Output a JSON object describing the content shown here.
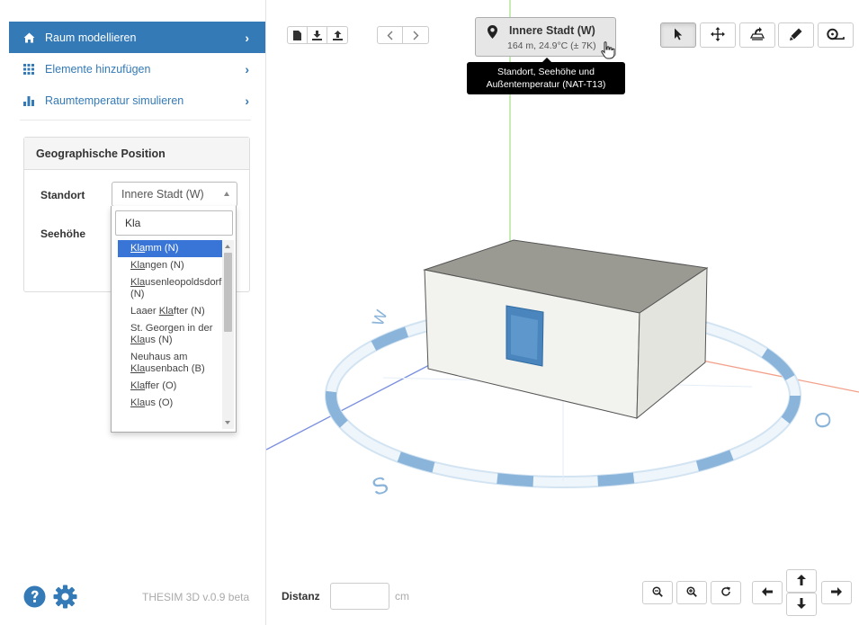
{
  "sidebar": {
    "nav": [
      {
        "label": "Raum modellieren",
        "icon": "home-icon",
        "active": true
      },
      {
        "label": "Elemente hinzufügen",
        "icon": "grid-icon",
        "active": false
      },
      {
        "label": "Raumtemperatur simulieren",
        "icon": "bar-chart-icon",
        "active": false
      }
    ],
    "panel": {
      "title": "Geographische Position",
      "location_label": "Standort",
      "altitude_label": "Seehöhe",
      "selected_location": "Innere Stadt (W)"
    },
    "dropdown": {
      "search_value": "Kla",
      "options": [
        {
          "before": "",
          "match": "Kla",
          "after": "mm (N)",
          "highlighted": true
        },
        {
          "before": "",
          "match": "Kla",
          "after": "ngen (N)",
          "highlighted": false
        },
        {
          "before": "",
          "match": "Kla",
          "after": "usenleopoldsdorf (N)",
          "highlighted": false
        },
        {
          "before": "Laaer ",
          "match": "Kla",
          "after": "fter (N)",
          "highlighted": false
        },
        {
          "before": "St. Georgen in der ",
          "match": "Kla",
          "after": "us (N)",
          "highlighted": false
        },
        {
          "before": "Neuhaus am ",
          "match": "Kla",
          "after": "usenbach (B)",
          "highlighted": false
        },
        {
          "before": "",
          "match": "Kla",
          "after": "ffer (O)",
          "highlighted": false
        },
        {
          "before": "",
          "match": "Kla",
          "after": "us (O)",
          "highlighted": false
        }
      ]
    },
    "footer": {
      "help_icon": "question-circle-icon",
      "settings_icon": "gear-icon",
      "version": "THESIM 3D v.0.9 beta"
    }
  },
  "location_button": {
    "title": "Innere Stadt (W)",
    "subtitle": "164 m, 24.9°C (± 7K)",
    "tooltip": [
      "Standort, Seehöhe und",
      "Außentemperatur (NAT-T13)"
    ]
  },
  "toolbar_left": [
    "new-file-icon",
    "download-icon",
    "upload-icon",
    "undo-icon",
    "redo-icon"
  ],
  "toolbar_right": [
    {
      "icon": "select-cursor-icon",
      "active": true
    },
    {
      "icon": "move-icon",
      "active": false
    },
    {
      "icon": "rotate-object-icon",
      "active": false
    },
    {
      "icon": "pencil-icon",
      "active": false
    },
    {
      "icon": "tape-measure-icon",
      "active": false
    }
  ],
  "compass_labels": {
    "south": "S",
    "east": "O",
    "west": "W"
  },
  "bottom_bar": {
    "distance_label": "Distanz",
    "distance_value": "",
    "unit": "cm"
  },
  "colors": {
    "primary": "#337ab7",
    "compass": "#8ab4da",
    "box_top": "#9a9a92",
    "window": "#4a86bd",
    "axis_x": "#f2a08a",
    "axis_y": "#a8e08c",
    "axis_z": "#7a8fe0"
  }
}
